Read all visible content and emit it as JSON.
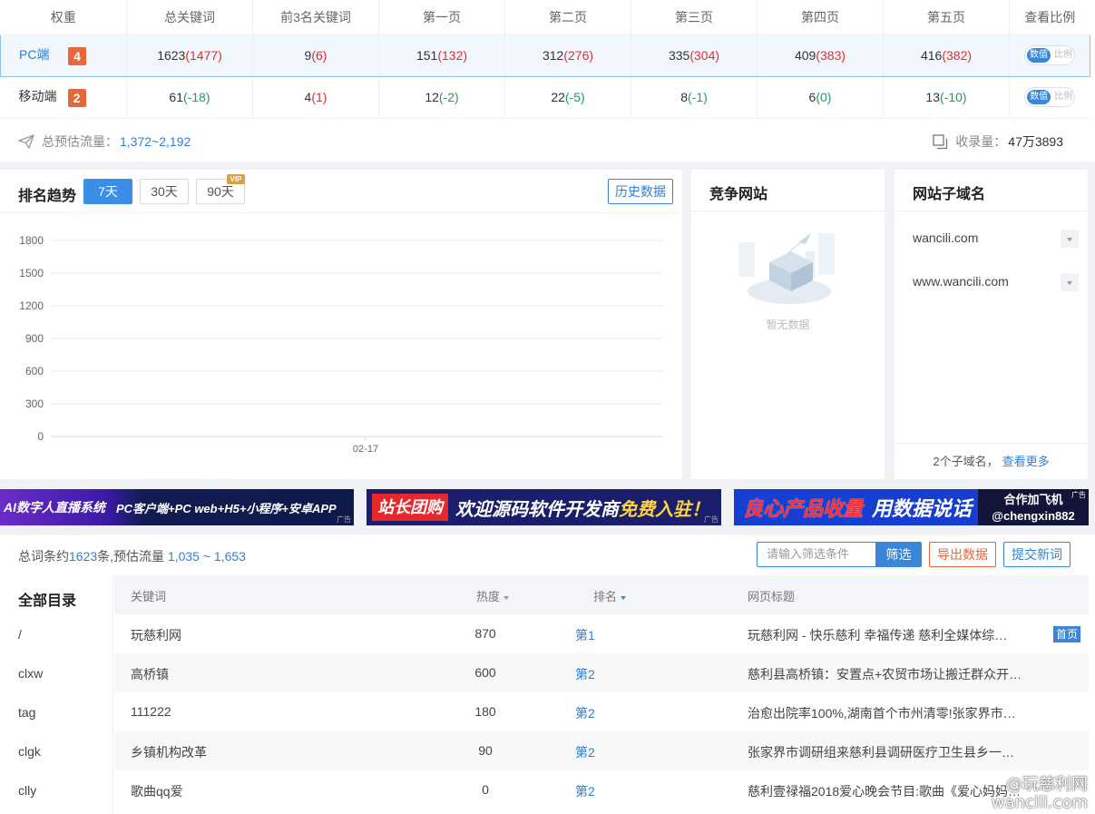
{
  "weights_table": {
    "headers": [
      "权重",
      "总关键词",
      "前3名关键词",
      "第一页",
      "第二页",
      "第三页",
      "第四页",
      "第五页",
      "查看比例"
    ],
    "rows": [
      {
        "label": "PC端",
        "badge": "4",
        "cells": [
          {
            "main": "1623",
            "delta": "(1477)",
            "tone": "red"
          },
          {
            "main": "9",
            "delta": "(6)",
            "tone": "red"
          },
          {
            "main": "151",
            "delta": "(132)",
            "tone": "red"
          },
          {
            "main": "312",
            "delta": "(276)",
            "tone": "red"
          },
          {
            "main": "335",
            "delta": "(304)",
            "tone": "red"
          },
          {
            "main": "409",
            "delta": "(383)",
            "tone": "red"
          },
          {
            "main": "416",
            "delta": "(382)",
            "tone": "red"
          }
        ]
      },
      {
        "label": "移动端",
        "badge": "2",
        "cells": [
          {
            "main": "61",
            "delta": "(-18)",
            "tone": "green"
          },
          {
            "main": "4",
            "delta": "(1)",
            "tone": "red"
          },
          {
            "main": "12",
            "delta": "(-2)",
            "tone": "green"
          },
          {
            "main": "22",
            "delta": "(-5)",
            "tone": "green"
          },
          {
            "main": "8",
            "delta": "(-1)",
            "tone": "green"
          },
          {
            "main": "6",
            "delta": "(0)",
            "tone": "green"
          },
          {
            "main": "13",
            "delta": "(-10)",
            "tone": "green"
          }
        ]
      }
    ],
    "toggle_on": "数值",
    "toggle_off": "比例"
  },
  "summary": {
    "flow_label": "总预估流量：",
    "flow_value": "1,372~2,192",
    "index_label": "收录量：",
    "index_value": "47万3893"
  },
  "trend": {
    "title": "排名趋势",
    "ranges": [
      "7天",
      "30天",
      "90天"
    ],
    "active_range": 0,
    "vip_tag": "VIP",
    "history_label": "历史数据"
  },
  "chart_data": {
    "type": "line",
    "title": "",
    "xlabel": "",
    "ylabel": "",
    "x": [
      "02-17"
    ],
    "series": [],
    "yticks": [
      0,
      300,
      600,
      900,
      1200,
      1500,
      1800
    ],
    "ylim": [
      0,
      1800
    ],
    "grid": true
  },
  "competitors": {
    "title": "竞争网站",
    "empty_text": "暂无数据"
  },
  "subdomains": {
    "title": "网站子域名",
    "items": [
      "wancili.com",
      "www.wancili.com"
    ],
    "footer_count": "2个子域名，",
    "footer_more": "查看更多"
  },
  "banners": [
    {
      "part_a": "AI数字人直播系统",
      "part_b": "PC客户端+PC web+H5+小程序+安卓APP",
      "ad": "广告"
    },
    {
      "part_a": "站长团购",
      "part_b": "欢迎源码软件开发商",
      "part_c": "免费入驻！",
      "ad": "广告"
    },
    {
      "part_a": "良心产品收量",
      "part_b": "用数据说话",
      "part_c1": "合作加飞机",
      "part_c2": "@chengxin882",
      "ad": "广告"
    }
  ],
  "keywords": {
    "summary_prefix": "总词条约",
    "summary_count": "1623",
    "summary_mid": "条,预估流量 ",
    "summary_flow": "1,035 ~ 1,653",
    "filter_placeholder": "请输入筛选条件",
    "filter_btn": "筛选",
    "export_btn": "导出数据",
    "submit_btn": "提交新词",
    "dir_title": "全部目录",
    "dirs": [
      "/",
      "clxw",
      "tag",
      "clgk",
      "clly"
    ],
    "col_keyword": "关键词",
    "col_heat": "热度",
    "col_rank": "排名",
    "col_title": "网页标题",
    "rows": [
      {
        "kw": "玩慈利网",
        "heat": "870",
        "rank": "第1",
        "title": "玩慈利网 - 快乐慈利 幸福传递 慈利全媒体综…",
        "tag": "首页"
      },
      {
        "kw": "高桥镇",
        "heat": "600",
        "rank": "第2",
        "title": "慈利县高桥镇：安置点+农贸市场让搬迁群众开…",
        "tag": ""
      },
      {
        "kw": "111222",
        "heat": "180",
        "rank": "第2",
        "title": "治愈出院率100%,湖南首个市州清零!张家界市…",
        "tag": ""
      },
      {
        "kw": "乡镇机构改革",
        "heat": "90",
        "rank": "第2",
        "title": "张家界市调研组来慈利县调研医疗卫生县乡一…",
        "tag": ""
      },
      {
        "kw": "歌曲qq爱",
        "heat": "0",
        "rank": "第2",
        "title": "慈利壹禄福2018爱心晚会节目:歌曲《爱心妈妈…",
        "tag": ""
      }
    ]
  },
  "watermark": {
    "line1": "@玩慈利网",
    "line2": "wancili.com"
  }
}
